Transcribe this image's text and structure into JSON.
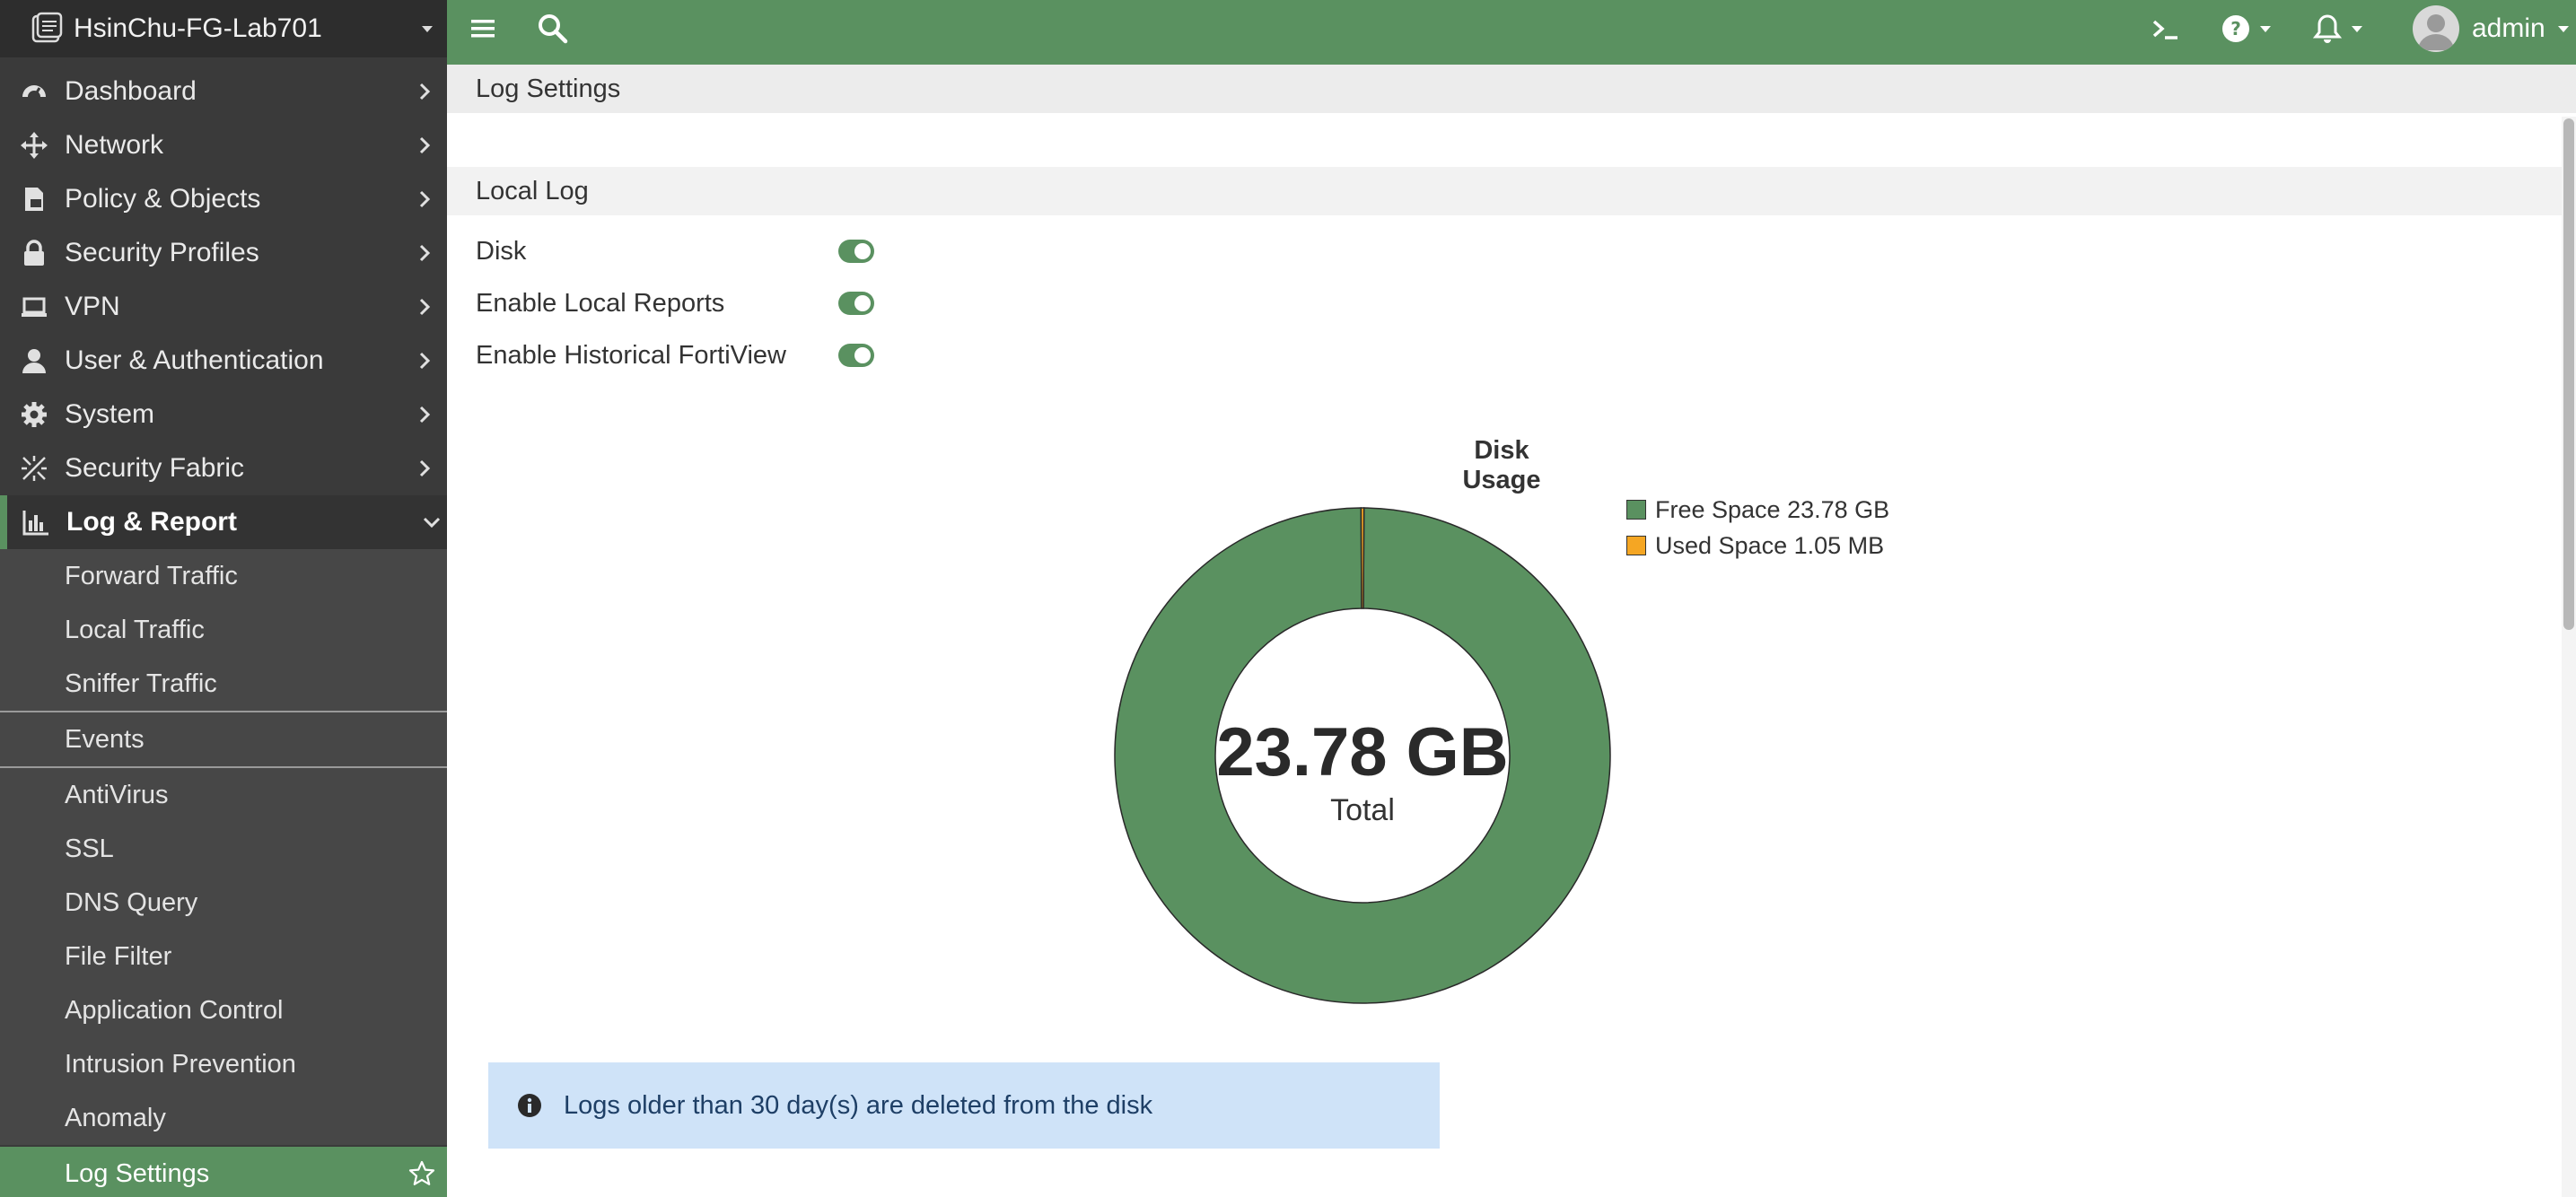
{
  "device": {
    "name": "HsinChu-FG-Lab701"
  },
  "sidebar": {
    "items": [
      {
        "label": "Dashboard",
        "icon": "dashboard-icon"
      },
      {
        "label": "Network",
        "icon": "network-icon"
      },
      {
        "label": "Policy & Objects",
        "icon": "policy-icon"
      },
      {
        "label": "Security Profiles",
        "icon": "lock-icon"
      },
      {
        "label": "VPN",
        "icon": "laptop-icon"
      },
      {
        "label": "User & Authentication",
        "icon": "user-icon"
      },
      {
        "label": "System",
        "icon": "gear-icon"
      },
      {
        "label": "Security Fabric",
        "icon": "fabric-icon"
      },
      {
        "label": "Log & Report",
        "icon": "chart-icon"
      }
    ],
    "subitems": [
      {
        "label": "Forward Traffic"
      },
      {
        "label": "Local Traffic"
      },
      {
        "label": "Sniffer Traffic"
      },
      {
        "label": "Events"
      },
      {
        "label": "AntiVirus"
      },
      {
        "label": "SSL"
      },
      {
        "label": "DNS Query"
      },
      {
        "label": "File Filter"
      },
      {
        "label": "Application Control"
      },
      {
        "label": "Intrusion Prevention"
      },
      {
        "label": "Anomaly"
      },
      {
        "label": "Log Settings"
      }
    ]
  },
  "topbar": {
    "user": "admin"
  },
  "main": {
    "page_title": "Log Settings",
    "section_title": "Local Log",
    "settings": [
      {
        "label": "Disk",
        "enabled": true
      },
      {
        "label": "Enable Local Reports",
        "enabled": true
      },
      {
        "label": "Enable Historical FortiView",
        "enabled": true
      }
    ],
    "info": "Logs older than 30 day(s) are deleted from the disk"
  },
  "colors": {
    "accent": "#5a9160",
    "used": "#f5a623",
    "sidebar": "#3a3a3a",
    "info_bg": "#cfe3f8"
  },
  "chart_data": {
    "type": "pie",
    "title": "Disk Usage",
    "center_value": "23.78 GB",
    "center_label": "Total",
    "legend": [
      "Free Space 23.78 GB",
      "Used Space 1.05 MB"
    ],
    "slices": [
      {
        "name": "Free Space",
        "value": 23.78,
        "unit": "GB",
        "color": "#5a9160"
      },
      {
        "name": "Used Space",
        "value": 1.05,
        "unit": "MB",
        "color": "#f5a623"
      }
    ]
  }
}
